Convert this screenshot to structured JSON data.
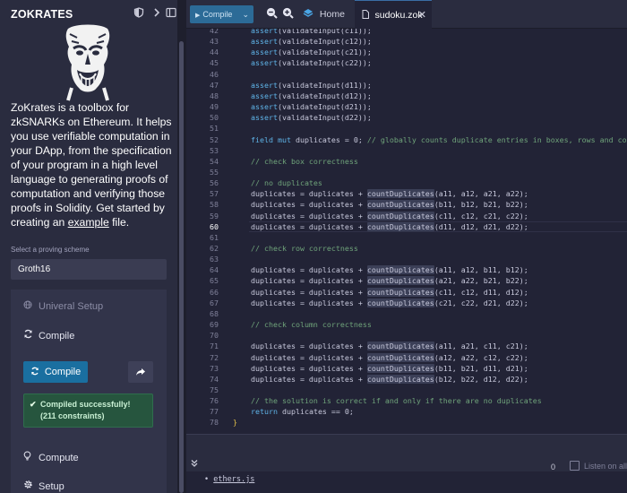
{
  "plugin": {
    "title": "ZOKRATES",
    "intro_before_link": "ZoKrates is a toolbox for zkSNARKs on Ethereum. It helps you use verifiable computation in your DApp, from the specification of your program in a high level language to generating proofs of computation and verifying those proofs in Solidity. Get started by creating an ",
    "intro_link": "example",
    "intro_after_link": " file.",
    "proving_scheme_label": "Select a proving scheme",
    "proving_scheme_value": "Groth16",
    "steps": {
      "setup": "Univeral Setup",
      "compile": "Compile",
      "compile_button": "Compile",
      "success_line1": "Compiled successfully!",
      "success_line2": "(211 constraints)",
      "compute": "Compute",
      "setup2": "Setup"
    }
  },
  "topbar": {
    "compile_dropdown": "Compile",
    "tab_home": "Home",
    "tab_file": "sudoku.zok"
  },
  "editor": {
    "current_line": 60,
    "lines": [
      {
        "n": 42,
        "code": [
          [
            "fn",
            "assert"
          ],
          [
            "op",
            "(validateInput("
          ],
          [
            "op",
            "c11"
          ],
          [
            "op",
            "));"
          ]
        ]
      },
      {
        "n": 43,
        "code": [
          [
            "fn",
            "assert"
          ],
          [
            "op",
            "(validateInput(c12));"
          ]
        ]
      },
      {
        "n": 44,
        "code": [
          [
            "fn",
            "assert"
          ],
          [
            "op",
            "(validateInput(c21));"
          ]
        ]
      },
      {
        "n": 45,
        "code": [
          [
            "fn",
            "assert"
          ],
          [
            "op",
            "(validateInput(c22));"
          ]
        ]
      },
      {
        "n": 46,
        "code": []
      },
      {
        "n": 47,
        "code": [
          [
            "fn",
            "assert"
          ],
          [
            "op",
            "(validateInput(d11));"
          ]
        ]
      },
      {
        "n": 48,
        "code": [
          [
            "fn",
            "assert"
          ],
          [
            "op",
            "(validateInput(d12));"
          ]
        ]
      },
      {
        "n": 49,
        "code": [
          [
            "fn",
            "assert"
          ],
          [
            "op",
            "(validateInput(d21));"
          ]
        ]
      },
      {
        "n": 50,
        "code": [
          [
            "fn",
            "assert"
          ],
          [
            "op",
            "(validateInput(d22));"
          ]
        ]
      },
      {
        "n": 51,
        "code": []
      },
      {
        "n": 52,
        "code": [
          [
            "kw",
            "field mut"
          ],
          [
            "op",
            " duplicates = 0; "
          ],
          [
            "cm",
            "// globally counts duplicate entries in boxes, rows and colu"
          ]
        ]
      },
      {
        "n": 53,
        "code": []
      },
      {
        "n": 54,
        "code": [
          [
            "cm",
            "// check box correctness"
          ]
        ]
      },
      {
        "n": 55,
        "code": []
      },
      {
        "n": 56,
        "code": [
          [
            "cm",
            "// no duplicates"
          ]
        ]
      },
      {
        "n": 57,
        "code": [
          [
            "op",
            "duplicates = duplicates + "
          ],
          [
            "hi",
            "countDuplicates"
          ],
          [
            "op",
            "(a11, a12, a21, a22);"
          ]
        ]
      },
      {
        "n": 58,
        "code": [
          [
            "op",
            "duplicates = duplicates + "
          ],
          [
            "hi",
            "countDuplicates"
          ],
          [
            "op",
            "(b11, b12, b21, b22);"
          ]
        ]
      },
      {
        "n": 59,
        "code": [
          [
            "op",
            "duplicates = duplicates + "
          ],
          [
            "hi",
            "countDuplicates"
          ],
          [
            "op",
            "(c11, c12, c21, c22);"
          ]
        ]
      },
      {
        "n": 60,
        "code": [
          [
            "op",
            "duplicates = duplicates + "
          ],
          [
            "hi",
            "countDuplicates"
          ],
          [
            "op",
            "(d11, d12, d21, d22);"
          ]
        ]
      },
      {
        "n": 61,
        "code": []
      },
      {
        "n": 62,
        "code": [
          [
            "cm",
            "// check row correctness"
          ]
        ]
      },
      {
        "n": 63,
        "code": []
      },
      {
        "n": 64,
        "code": [
          [
            "op",
            "duplicates = duplicates + "
          ],
          [
            "hi",
            "countDuplicates"
          ],
          [
            "op",
            "(a11, a12, b11, b12);"
          ]
        ]
      },
      {
        "n": 65,
        "code": [
          [
            "op",
            "duplicates = duplicates + "
          ],
          [
            "hi",
            "countDuplicates"
          ],
          [
            "op",
            "(a21, a22, b21, b22);"
          ]
        ]
      },
      {
        "n": 66,
        "code": [
          [
            "op",
            "duplicates = duplicates + "
          ],
          [
            "hi",
            "countDuplicates"
          ],
          [
            "op",
            "(c11, c12, d11, d12);"
          ]
        ]
      },
      {
        "n": 67,
        "code": [
          [
            "op",
            "duplicates = duplicates + "
          ],
          [
            "hi",
            "countDuplicates"
          ],
          [
            "op",
            "(c21, c22, d21, d22);"
          ]
        ]
      },
      {
        "n": 68,
        "code": []
      },
      {
        "n": 69,
        "code": [
          [
            "cm",
            "// check column correctness"
          ]
        ]
      },
      {
        "n": 70,
        "code": []
      },
      {
        "n": 71,
        "code": [
          [
            "op",
            "duplicates = duplicates + "
          ],
          [
            "hi",
            "countDuplicates"
          ],
          [
            "op",
            "(a11, a21, c11, c21);"
          ]
        ]
      },
      {
        "n": 72,
        "code": [
          [
            "op",
            "duplicates = duplicates + "
          ],
          [
            "hi",
            "countDuplicates"
          ],
          [
            "op",
            "(a12, a22, c12, c22);"
          ]
        ]
      },
      {
        "n": 73,
        "code": [
          [
            "op",
            "duplicates = duplicates + "
          ],
          [
            "hi",
            "countDuplicates"
          ],
          [
            "op",
            "(b11, b21, d11, d21);"
          ]
        ]
      },
      {
        "n": 74,
        "code": [
          [
            "op",
            "duplicates = duplicates + "
          ],
          [
            "hi",
            "countDuplicates"
          ],
          [
            "op",
            "(b12, b22, d12, d22);"
          ]
        ]
      },
      {
        "n": 75,
        "code": []
      },
      {
        "n": 76,
        "code": [
          [
            "cm",
            "// the solution is correct if and only if there are no duplicates"
          ]
        ]
      },
      {
        "n": 77,
        "code": [
          [
            "kw",
            "return"
          ],
          [
            "op",
            " duplicates == 0;"
          ]
        ]
      },
      {
        "n": 78,
        "code": [
          [
            "br",
            "}"
          ]
        ]
      }
    ]
  },
  "terminal": {
    "count": "0",
    "listen_label": "Listen on all",
    "item": "ethers.js"
  }
}
